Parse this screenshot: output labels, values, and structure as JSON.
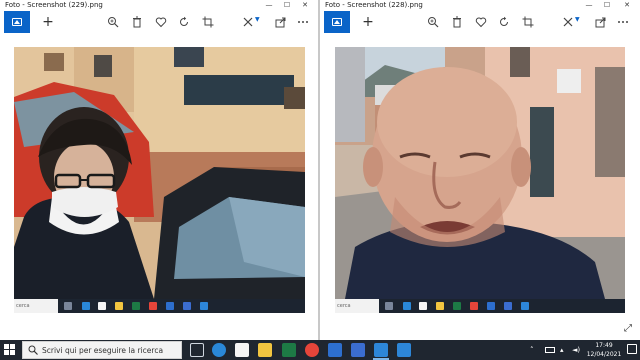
{
  "windows": [
    {
      "title": "Foto - Screenshot (229).png",
      "controls": [
        "—",
        "☐",
        "✕"
      ],
      "mini_search_placeholder": "cerca"
    },
    {
      "title": "Foto - Screenshot (228).png",
      "controls": [
        "—",
        "☐",
        "✕"
      ],
      "mini_search_placeholder": "cerca"
    }
  ],
  "toolbar": {
    "add_label": "+",
    "icons": [
      "home-photo-icon",
      "add-icon",
      "zoom-icon",
      "delete-icon",
      "favorite-icon",
      "rotate-icon",
      "crop-icon",
      "edit-icon",
      "share-icon",
      "print-icon",
      "more-icon"
    ]
  },
  "taskbar": {
    "search_placeholder": "Scrivi qui per eseguire la ricerca",
    "apps": [
      "task-view",
      "edge",
      "store",
      "file-explorer",
      "excel",
      "chrome",
      "photos",
      "word",
      "photos-app"
    ],
    "time": "17:49",
    "date": "12/04/2021"
  },
  "colors": {
    "accent": "#0a64c8",
    "taskbar": "#1f2630"
  }
}
